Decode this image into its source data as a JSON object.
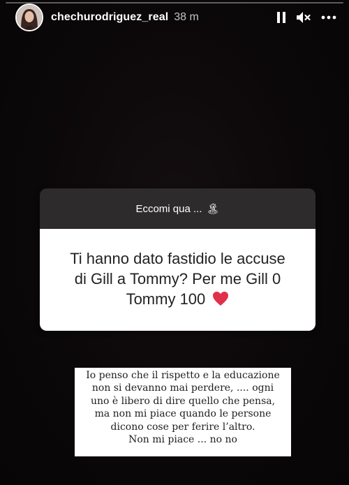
{
  "story": {
    "progress": 0.0,
    "username": "chechurodriguez_real",
    "time": "38 m"
  },
  "controls": {
    "pause_icon": "pause-icon",
    "mute_icon": "muted-speaker-icon",
    "more_icon": "more-options-icon"
  },
  "question": {
    "header": "Eccomi qua ...",
    "header_emoji": "🏝",
    "lines": [
      "Ti hanno dato fastidio le accuse",
      "di Gill a Tommy? Per me Gill 0",
      "Tommy 100"
    ],
    "heart_icon": "red-heart-icon"
  },
  "answer": {
    "lines": [
      "Io penso che il rispetto e la educazione",
      "non si devanno mai perdere, .... ogni",
      "uno è libero di dire quello che pensa,",
      "ma non mi piace quando le persone",
      "dicono cose per ferire l’altro.",
      "Non mi piace ... no no"
    ]
  },
  "colors": {
    "background": "#0a0708",
    "question_header_bg": "#2e2b2c",
    "heart": "#e0314b"
  }
}
